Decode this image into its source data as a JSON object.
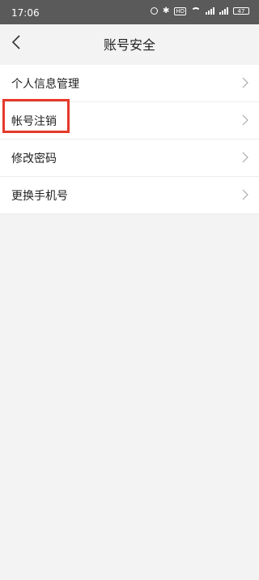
{
  "status_bar": {
    "time": "17:06",
    "battery": "47"
  },
  "header": {
    "title": "账号安全"
  },
  "menu": {
    "items": [
      {
        "label": "个人信息管理"
      },
      {
        "label": "帐号注销"
      },
      {
        "label": "修改密码"
      },
      {
        "label": "更换手机号"
      }
    ]
  },
  "colors": {
    "highlight_border": "#e53a2a",
    "status_bar_bg": "#5a5a5a",
    "page_bg": "#f3f3f3"
  }
}
